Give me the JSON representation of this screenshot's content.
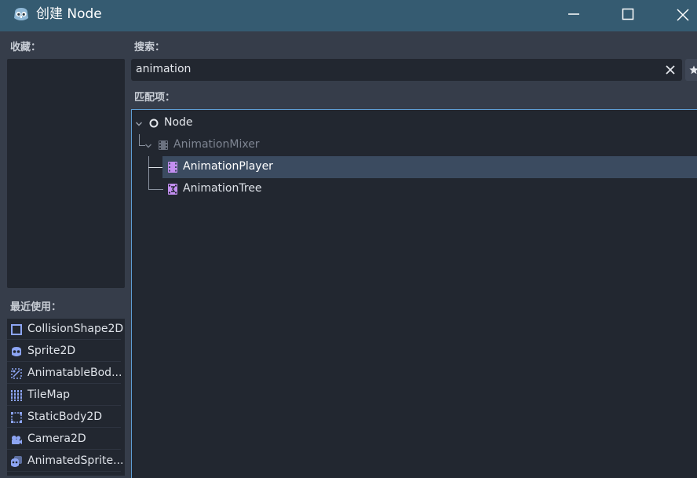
{
  "window": {
    "title": "创建 Node",
    "icons": {
      "app": "godot-icon",
      "minimize": "minimize-icon",
      "maximize": "maximize-icon",
      "close": "close-icon"
    }
  },
  "favorites": {
    "label": "收藏："
  },
  "recent": {
    "label": "最近使用：",
    "items": [
      {
        "label": "CollisionShape2D",
        "icon": "collision-shape-icon"
      },
      {
        "label": "Sprite2D",
        "icon": "sprite-icon"
      },
      {
        "label": "AnimatableBod...",
        "icon": "animatable-body-icon"
      },
      {
        "label": "TileMap",
        "icon": "tilemap-icon"
      },
      {
        "label": "StaticBody2D",
        "icon": "static-body-icon"
      },
      {
        "label": "Camera2D",
        "icon": "camera-icon"
      },
      {
        "label": "AnimatedSprite...",
        "icon": "animated-sprite-icon"
      }
    ]
  },
  "search": {
    "label": "搜索：",
    "value": "animation"
  },
  "matches": {
    "label": "匹配项：",
    "tree": [
      {
        "label": "Node",
        "icon": "node-circle-icon",
        "depth": 0,
        "expanded": true,
        "dimmed": false,
        "selected": false
      },
      {
        "label": "AnimationMixer",
        "icon": "animation-mixer-icon",
        "depth": 1,
        "expanded": true,
        "dimmed": true,
        "selected": false
      },
      {
        "label": "AnimationPlayer",
        "icon": "animation-player-icon",
        "depth": 2,
        "expanded": false,
        "dimmed": false,
        "selected": true
      },
      {
        "label": "AnimationTree",
        "icon": "animation-tree-icon",
        "depth": 2,
        "expanded": false,
        "dimmed": false,
        "selected": false
      }
    ]
  },
  "colors": {
    "titlebar": "#355b71",
    "background": "#363d4a",
    "panel": "#222730",
    "selection": "#3b4b60",
    "accent_border": "#5f9ed4",
    "node_icon_purple": "#c38ef1",
    "icon_blue": "#8da5f3"
  }
}
